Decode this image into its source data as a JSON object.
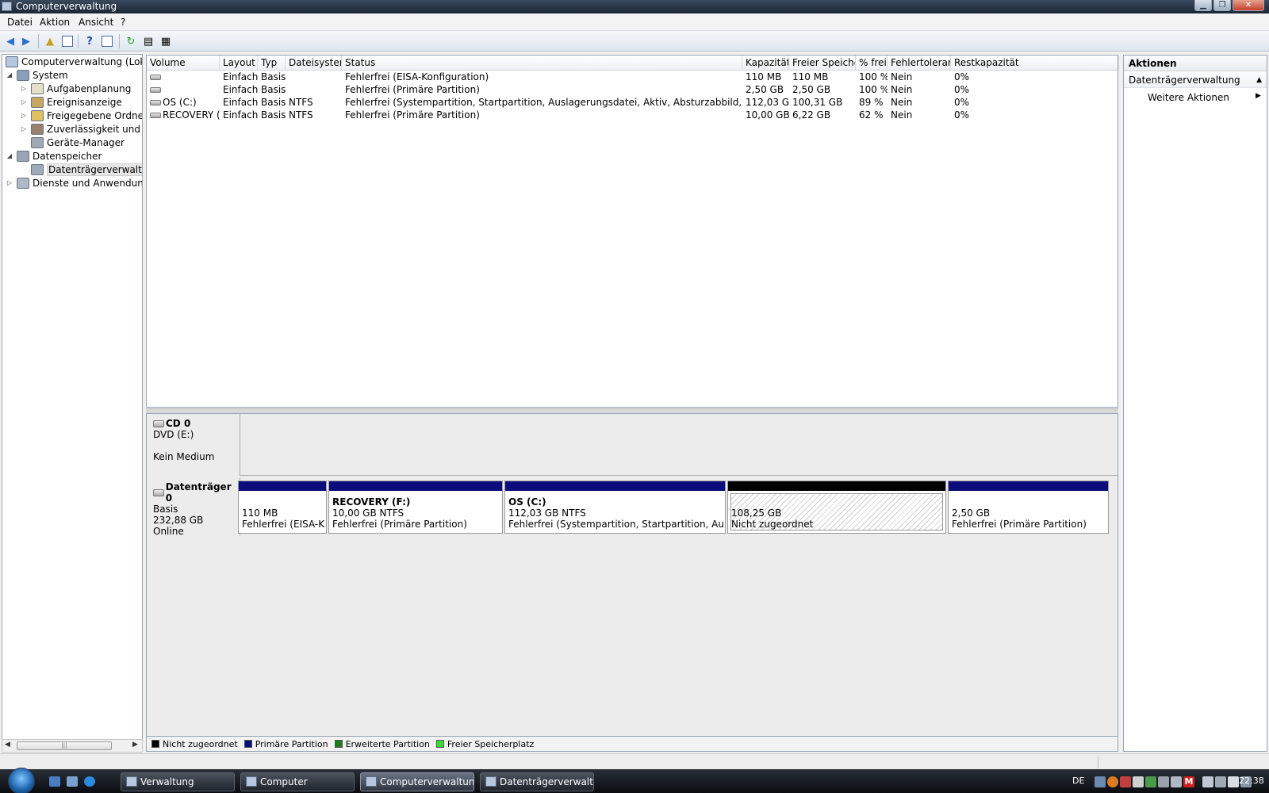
{
  "window": {
    "title": "Computerverwaltung"
  },
  "menu": [
    "Datei",
    "Aktion",
    "Ansicht",
    "?"
  ],
  "tree": {
    "root": "Computerverwaltung (Lokal)",
    "items": [
      {
        "label": "System",
        "level": 1,
        "exp": "◢",
        "icon": "tools-icon"
      },
      {
        "label": "Aufgabenplanung",
        "level": 2,
        "exp": "▷",
        "icon": "clock-icon"
      },
      {
        "label": "Ereignisanzeige",
        "level": 2,
        "exp": "▷",
        "icon": "event-viewer-icon"
      },
      {
        "label": "Freigegebene Ordner",
        "level": 2,
        "exp": "▷",
        "icon": "shared-folder-icon"
      },
      {
        "label": "Zuverlässigkeit und Leis",
        "level": 2,
        "exp": "▷",
        "icon": "reliability-icon"
      },
      {
        "label": "Geräte-Manager",
        "level": 2,
        "exp": "",
        "icon": "device-manager-icon"
      },
      {
        "label": "Datenspeicher",
        "level": 1,
        "exp": "◢",
        "icon": "storage-icon"
      },
      {
        "label": "Datenträgerverwaltung",
        "level": 2,
        "exp": "",
        "icon": "disk-management-icon",
        "selected": true
      },
      {
        "label": "Dienste und Anwendungen",
        "level": 1,
        "exp": "▷",
        "icon": "services-icon"
      }
    ]
  },
  "volumes": {
    "columns": [
      "Volume",
      "Layout",
      "Typ",
      "Dateisystem",
      "Status",
      "Kapazität",
      "Freier Speicher",
      "% frei",
      "Fehlertoleranz",
      "Restkapazität"
    ],
    "rows": [
      [
        "",
        "Einfach",
        "Basis",
        "",
        "Fehlerfrei (EISA-Konfiguration)",
        "110 MB",
        "110 MB",
        "100 %",
        "Nein",
        "0%"
      ],
      [
        "",
        "Einfach",
        "Basis",
        "",
        "Fehlerfrei (Primäre Partition)",
        "2,50 GB",
        "2,50 GB",
        "100 %",
        "Nein",
        "0%"
      ],
      [
        "OS (C:)",
        "Einfach",
        "Basis",
        "NTFS",
        "Fehlerfrei (Systempartition, Startpartition, Auslagerungsdatei, Aktiv, Absturzabbild, Primäre Partition)",
        "112,03 GB",
        "100,31 GB",
        "89 %",
        "Nein",
        "0%"
      ],
      [
        "RECOVERY (F:)",
        "Einfach",
        "Basis",
        "NTFS",
        "Fehlerfrei (Primäre Partition)",
        "10,00 GB",
        "6,22 GB",
        "62 %",
        "Nein",
        "0%"
      ]
    ]
  },
  "cd": {
    "name": "CD 0",
    "type": "DVD (E:)",
    "status": "Kein Medium"
  },
  "disk0": {
    "name": "Datenträger 0",
    "type": "Basis",
    "size": "232,88 GB",
    "state": "Online",
    "partitions": [
      {
        "name": "",
        "size": "110 MB",
        "status": "Fehlerfrei (EISA-Kon",
        "kind": "primary"
      },
      {
        "name": "RECOVERY  (F:)",
        "size": "10,00 GB NTFS",
        "status": "Fehlerfrei (Primäre Partition)",
        "kind": "primary"
      },
      {
        "name": "OS  (C:)",
        "size": "112,03 GB NTFS",
        "status": "Fehlerfrei (Systempartition, Startpartition, Auslagerung",
        "kind": "primary"
      },
      {
        "name": "",
        "size": "108,25 GB",
        "status": "Nicht zugeordnet",
        "kind": "unallocated"
      },
      {
        "name": "",
        "size": "2,50 GB",
        "status": "Fehlerfrei (Primäre Partition)",
        "kind": "primary"
      }
    ]
  },
  "legend": [
    {
      "label": "Nicht zugeordnet",
      "color": "#000000"
    },
    {
      "label": "Primäre Partition",
      "color": "#0c0c7a"
    },
    {
      "label": "Erweiterte Partition",
      "color": "#1e7d1e"
    },
    {
      "label": "Freier Speicherplatz",
      "color": "#35e035"
    }
  ],
  "actions": {
    "header": "Aktionen",
    "section": "Datenträgerverwaltung",
    "more": "Weitere Aktionen"
  },
  "taskbar": {
    "tasks": [
      "Verwaltung",
      "Computer",
      "Computerverwaltung",
      "Datenträgerverwaltu..."
    ],
    "active_index": 2,
    "lang": "DE",
    "clock": "22:38"
  }
}
